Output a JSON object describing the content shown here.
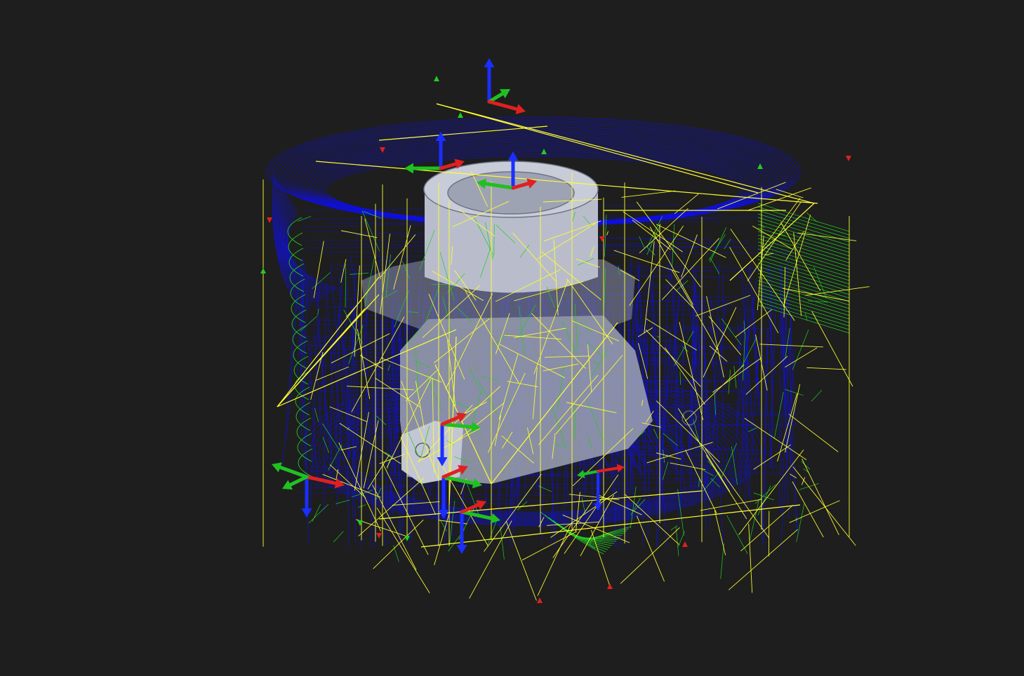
{
  "viewport": {
    "background": "#1e1e1e",
    "content": "cam-toolpath-3d-view"
  },
  "colors": {
    "background": "#1e1e1e",
    "part_body": "#b8bccb",
    "part_shadow": "#8a8fa0",
    "cutting_moves": "#1010e0",
    "rapid_moves": "#ffff33",
    "lead_moves": "#22cc22",
    "axis_x": "#e02020",
    "axis_y": "#20c020",
    "axis_z": "#1a2fff"
  },
  "triads": [
    {
      "name": "world-origin-triad",
      "kind": "world"
    },
    {
      "name": "tool-frame-1",
      "kind": "tool"
    },
    {
      "name": "tool-frame-2",
      "kind": "tool"
    },
    {
      "name": "tool-frame-3",
      "kind": "tool"
    },
    {
      "name": "tool-frame-4",
      "kind": "tool"
    },
    {
      "name": "tool-frame-5",
      "kind": "tool"
    },
    {
      "name": "fixture-frame",
      "kind": "fixture"
    }
  ]
}
